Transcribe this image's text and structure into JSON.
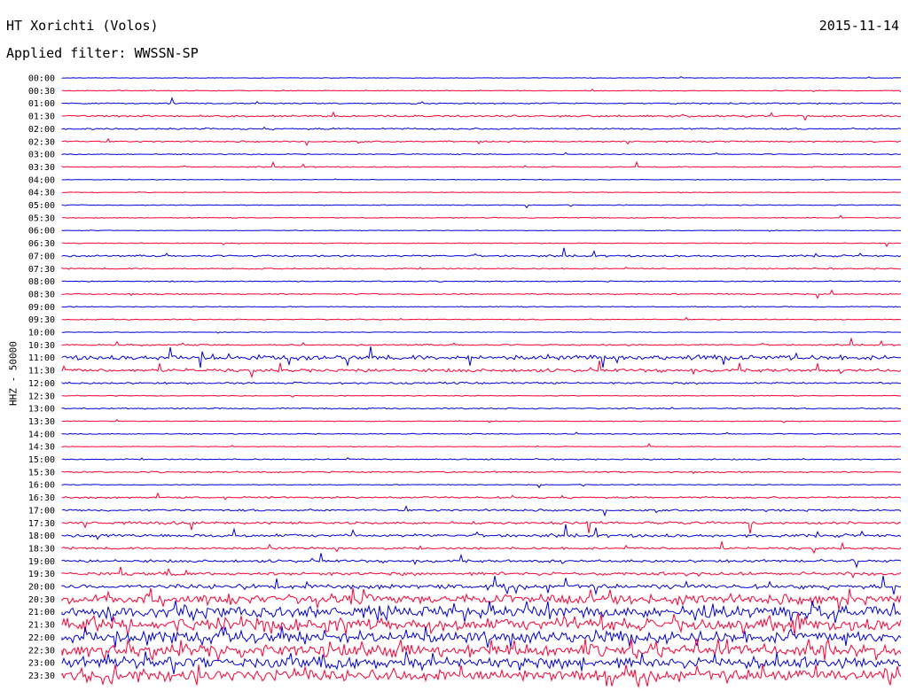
{
  "header": {
    "station": "HT Xorichti (Volos)",
    "date": "2015-11-14",
    "filter": "Applied filter: WWSSN-SP"
  },
  "chart_data": {
    "type": "line",
    "title": "HT Xorichti (Volos)",
    "ylabel": "HHZ - 50000",
    "colors": [
      "#0000dd",
      "#ff0033"
    ],
    "categories": [
      "00:00",
      "00:30",
      "01:00",
      "01:30",
      "02:00",
      "02:30",
      "03:00",
      "03:30",
      "04:00",
      "04:30",
      "05:00",
      "05:30",
      "06:00",
      "06:30",
      "07:00",
      "07:30",
      "08:00",
      "08:30",
      "09:00",
      "09:30",
      "10:00",
      "10:30",
      "11:00",
      "11:30",
      "12:00",
      "12:30",
      "13:00",
      "13:30",
      "14:00",
      "14:30",
      "15:00",
      "15:30",
      "16:00",
      "16:30",
      "17:00",
      "17:30",
      "18:00",
      "18:30",
      "19:00",
      "19:30",
      "20:00",
      "20:30",
      "21:00",
      "21:30",
      "22:00",
      "22:30",
      "23:00",
      "23:30"
    ],
    "activity": [
      0.3,
      0.4,
      0.6,
      0.9,
      0.8,
      0.7,
      0.5,
      0.5,
      0.3,
      0.3,
      0.4,
      0.4,
      0.3,
      0.4,
      0.9,
      0.6,
      0.5,
      0.6,
      0.4,
      0.5,
      0.3,
      0.7,
      2.2,
      1.6,
      0.9,
      0.4,
      0.6,
      0.4,
      0.5,
      0.3,
      0.6,
      0.7,
      0.4,
      0.9,
      1.0,
      1.3,
      1.5,
      1.1,
      1.3,
      1.6,
      2.2,
      4.8,
      5.4,
      6.0,
      5.6,
      5.8,
      5.2,
      5.6
    ]
  }
}
